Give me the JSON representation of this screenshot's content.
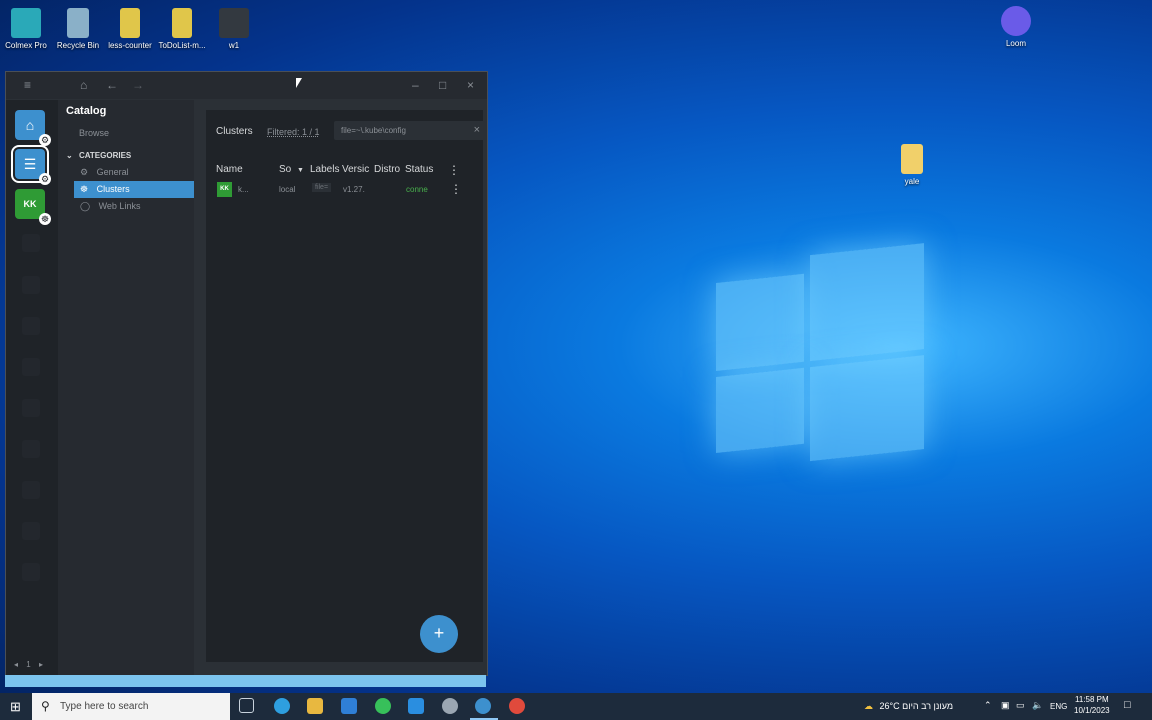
{
  "desktop": {
    "icons": [
      {
        "label": "Colmex Pro",
        "color": "#2aa9b8"
      },
      {
        "label": "Recycle Bin",
        "color": "#8ab0c8"
      },
      {
        "label": "less-counter",
        "color": "#e0c64a"
      },
      {
        "label": "ToDoList-m...",
        "color": "#e0c64a"
      },
      {
        "label": "w1",
        "color": "#333940"
      },
      {
        "label": "Loom",
        "color": "#6a5be8"
      },
      {
        "label": "yale",
        "color": "#f1d06a"
      }
    ]
  },
  "window": {
    "sidebar": {
      "title": "Catalog",
      "browse": "Browse",
      "categories_label": "CATEGORIES",
      "items": [
        {
          "label": "General"
        },
        {
          "label": "Clusters"
        },
        {
          "label": "Web Links"
        }
      ]
    },
    "hotbar": {
      "kk_label": "KK",
      "page": "1"
    },
    "main": {
      "title": "Clusters",
      "filtered": "Filtered: 1 / 1",
      "search_value": "file=~\\.kube\\config",
      "columns": [
        "Name",
        "So",
        "Labels",
        "Versic",
        "Distro",
        "Status"
      ],
      "row": {
        "badge": "KK",
        "name": "k...",
        "source": "local",
        "labels": "file=",
        "version": "v1.27.",
        "status": "conne"
      },
      "status_color": "#48b04c",
      "fab_label": "+"
    }
  },
  "taskbar": {
    "search_placeholder": "Type here to search",
    "weather": "26°C מעונן רב היום",
    "lang": "ENG",
    "time": "11:58 PM",
    "date": "10/1/2023"
  }
}
